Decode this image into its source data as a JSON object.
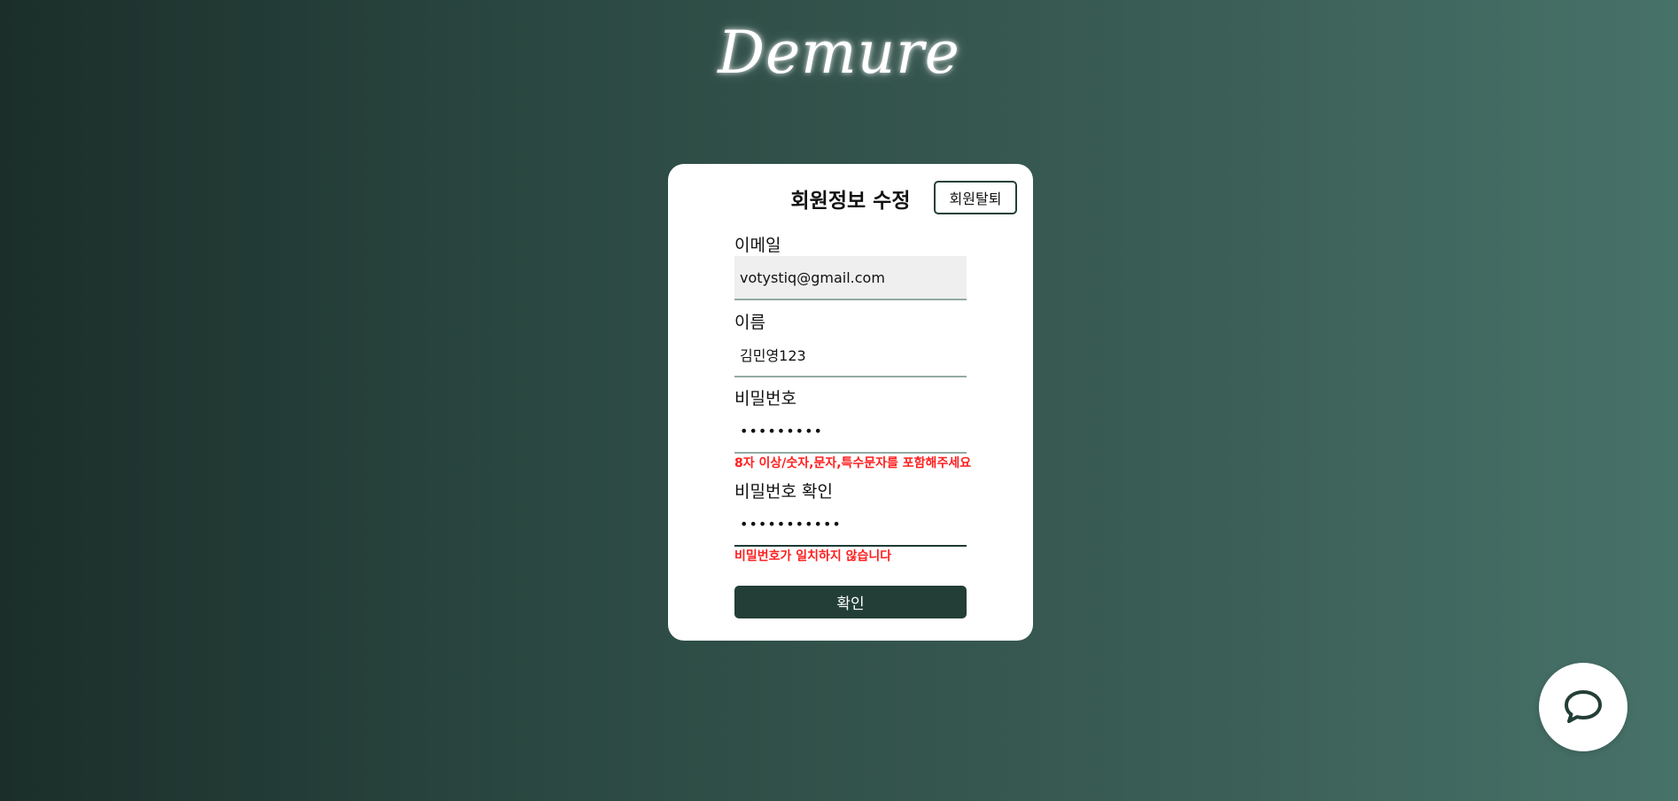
{
  "brand": {
    "logo_text": "Demure"
  },
  "form": {
    "title": "회원정보 수정",
    "withdraw_label": "회원탈퇴",
    "email": {
      "label": "이메일",
      "value": "votystiq@gmail.com"
    },
    "name": {
      "label": "이름",
      "value": "김민영123"
    },
    "password": {
      "label": "비밀번호",
      "value": "•••••••••",
      "error": "8자 이상/숫자,문자,특수문자를 포함해주세요"
    },
    "password_confirm": {
      "label": "비밀번호 확인",
      "value": "•••••••••••",
      "error": "비밀번호가 일치하지 않습니다"
    },
    "submit_label": "확인"
  },
  "chat": {
    "icon": "chat-bubble-icon"
  },
  "colors": {
    "accent": "#233e37",
    "error": "#ff1f1f",
    "bg_start": "#1b2e2a",
    "bg_end": "#477269"
  }
}
